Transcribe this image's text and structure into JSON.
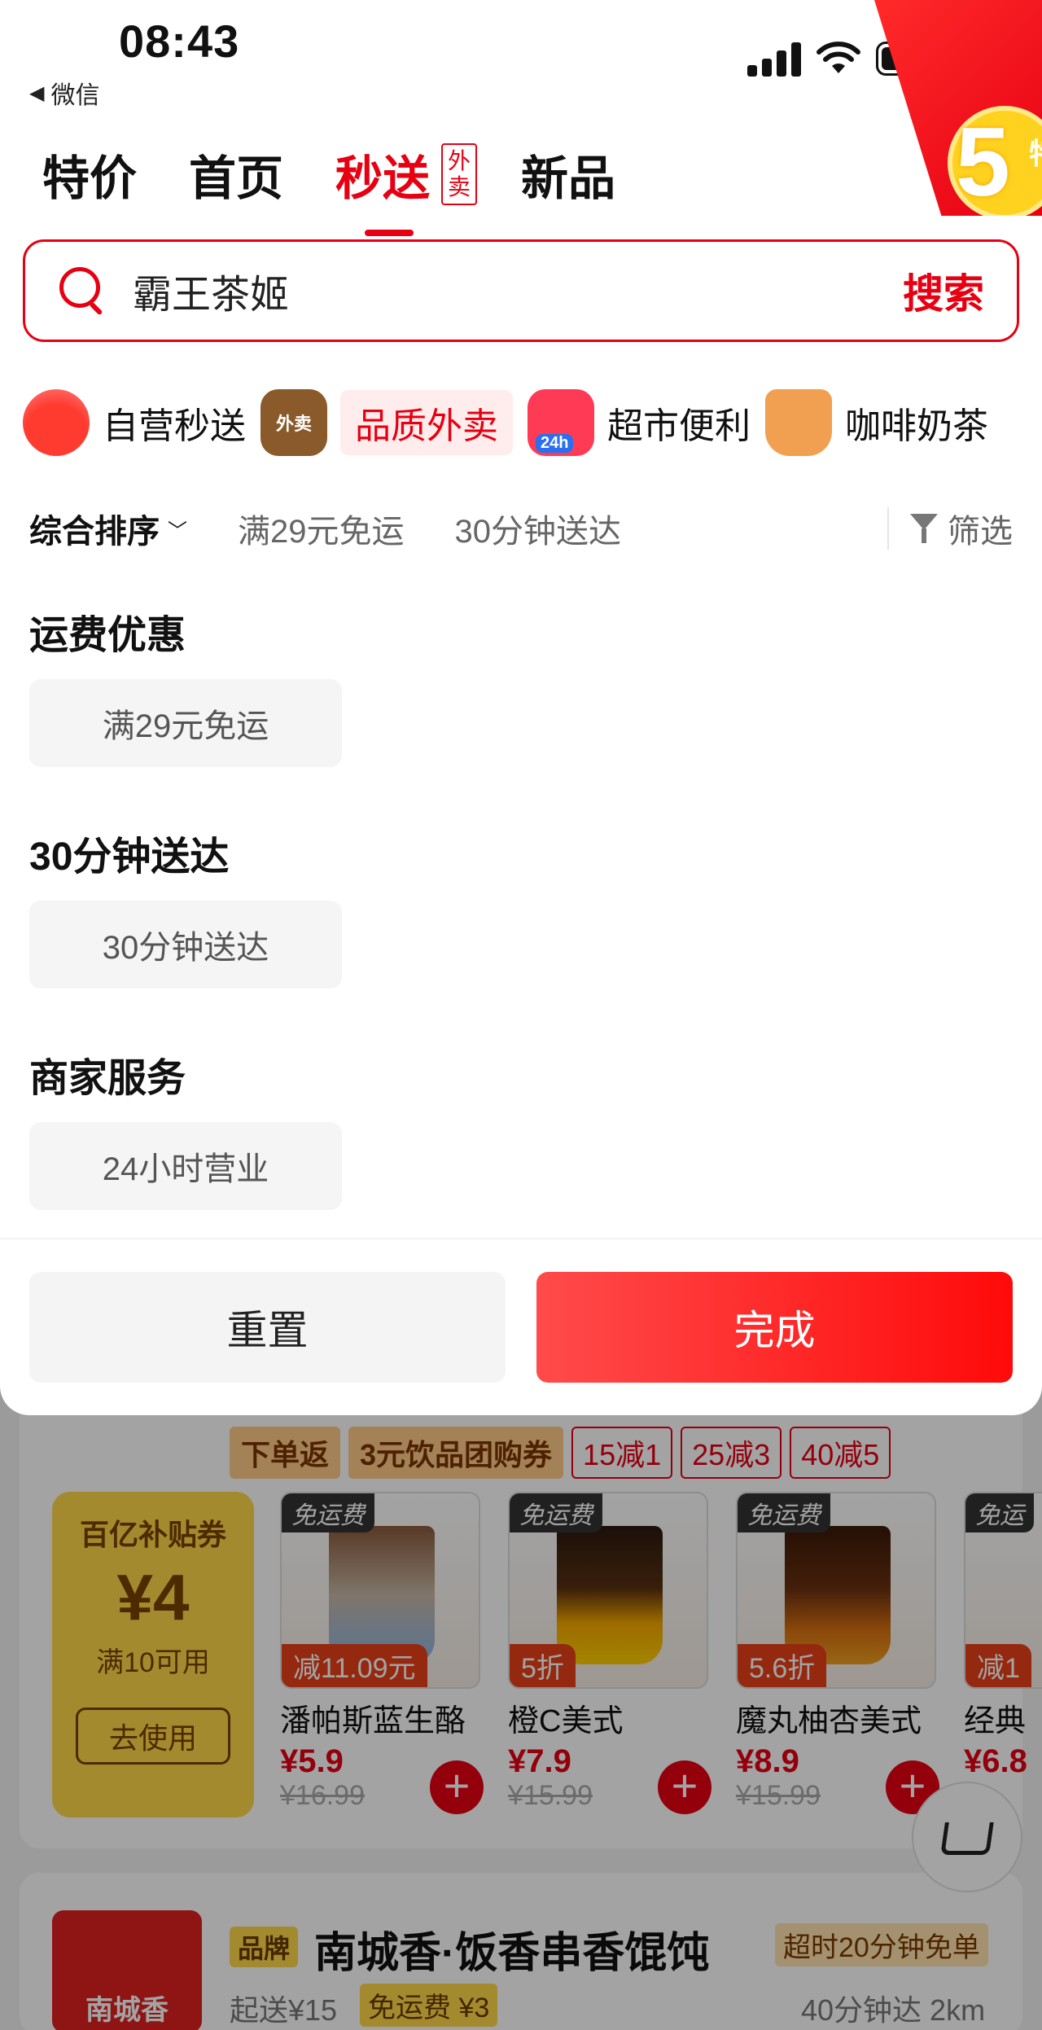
{
  "status_bar": {
    "time": "08:43",
    "back_label": "微信"
  },
  "promo_corner": {
    "number": "5",
    "text": "特"
  },
  "tabs": [
    {
      "label": "特价",
      "active": false
    },
    {
      "label": "首页",
      "active": false
    },
    {
      "label": "秒送",
      "active": true,
      "badge": "外卖"
    },
    {
      "label": "新品",
      "active": false
    }
  ],
  "search": {
    "value": "霸王茶姬",
    "button_label": "搜索"
  },
  "categories": [
    {
      "label": "自营秒送",
      "icon": "basket-icon",
      "selected": false
    },
    {
      "label": "品质外卖",
      "icon": "takeout-bag-icon",
      "icon_text": "外卖",
      "selected": true
    },
    {
      "label": "超市便利",
      "icon": "store-24h-icon",
      "icon_text": "24h",
      "selected": false
    },
    {
      "label": "咖啡奶茶",
      "icon": "coffee-cup-icon",
      "selected": false
    }
  ],
  "filter_bar": {
    "sort_label": "综合排序",
    "quick_filters": [
      "满29元免运",
      "30分钟送达"
    ],
    "filter_label": "筛选"
  },
  "filter_panel": {
    "sections": [
      {
        "title": "运费优惠",
        "option": "满29元免运"
      },
      {
        "title": "30分钟送达",
        "option": "30分钟送达"
      },
      {
        "title": "商家服务",
        "option": "24小时营业"
      }
    ],
    "reset_label": "重置",
    "done_label": "完成"
  },
  "background": {
    "strip": {
      "label": "下单返",
      "coupon": "3元饮品团购券",
      "offers": [
        "15减1",
        "25减3",
        "40减5"
      ]
    },
    "coupon": {
      "title": "百亿补贴券",
      "amount": "¥4",
      "condition": "满10可用",
      "use_label": "去使用"
    },
    "products": [
      {
        "name": "潘帕斯蓝生酪",
        "tag": "免运费",
        "discount": "减11.09元",
        "price": "¥5.9",
        "original": "¥16.99"
      },
      {
        "name": "橙C美式",
        "tag": "免运费",
        "discount": "5折",
        "price": "¥7.9",
        "original": "¥15.99"
      },
      {
        "name": "魔丸柚杏美式",
        "tag": "免运费",
        "discount": "5.6折",
        "price": "¥8.9",
        "original": "¥15.99"
      },
      {
        "name": "经典",
        "tag": "免运",
        "discount": "减1",
        "price": "¥6.8",
        "original": ""
      }
    ],
    "store": {
      "brand_tag": "品牌",
      "name": "南城香·饭香串香馄饨",
      "overtime_tag": "超时20分钟免单",
      "min_order": "起送¥15",
      "free_ship": "免运费 ¥3",
      "delivery": "40分钟达  2km",
      "logo_text": "南城香"
    }
  },
  "colors": {
    "accent": "#e60012",
    "coupon_yellow": "#ffd84a"
  }
}
